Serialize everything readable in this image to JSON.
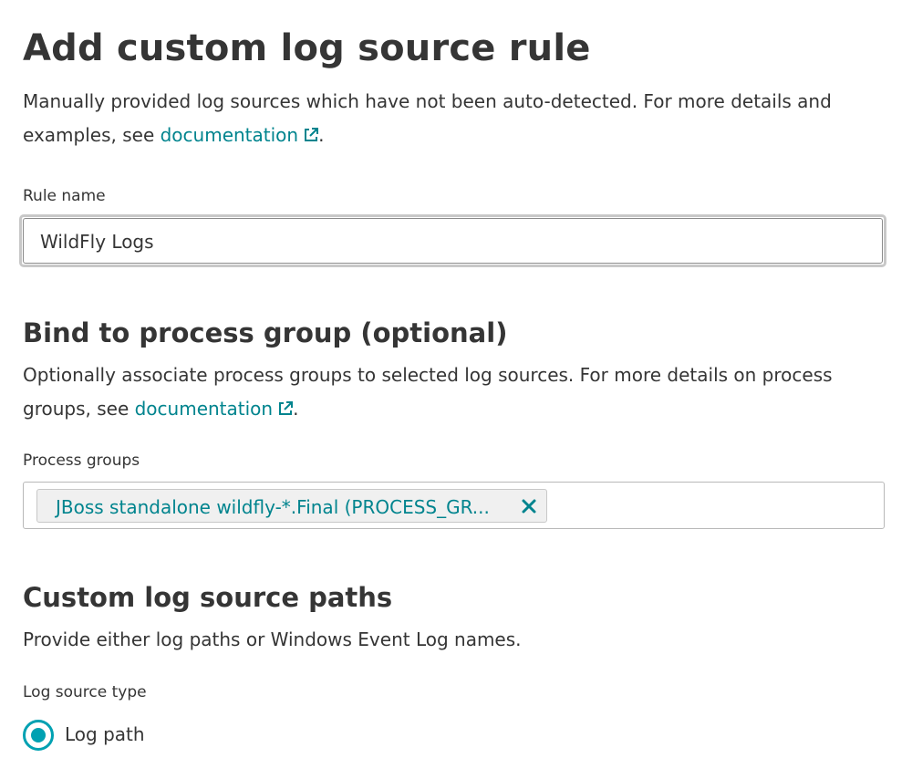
{
  "header": {
    "title": "Add custom log source rule",
    "description_prefix": "Manually provided log sources which have not been auto-detected. For more details and examples, see ",
    "doc_link": "documentation",
    "description_suffix": "."
  },
  "rule_name": {
    "label": "Rule name",
    "value": "WildFly Logs"
  },
  "process_group_section": {
    "title": "Bind to process group (optional)",
    "description_prefix": "Optionally associate process groups to selected log sources. For more details on process groups, see ",
    "doc_link": "documentation",
    "description_suffix": ".",
    "field_label": "Process groups",
    "selected": [
      "JBoss standalone wildfly-*.Final (PROCESS_GR..."
    ]
  },
  "paths_section": {
    "title": "Custom log source paths",
    "description": "Provide either log paths or Windows Event Log names.",
    "type_label": "Log source type",
    "type_options": [
      {
        "label": "Log path",
        "selected": true
      }
    ]
  },
  "colors": {
    "link": "#00848e",
    "accent": "#00a1b2",
    "text": "#353535"
  },
  "icons": [
    "external-link-icon",
    "remove-x-icon",
    "radio-selected-icon"
  ]
}
